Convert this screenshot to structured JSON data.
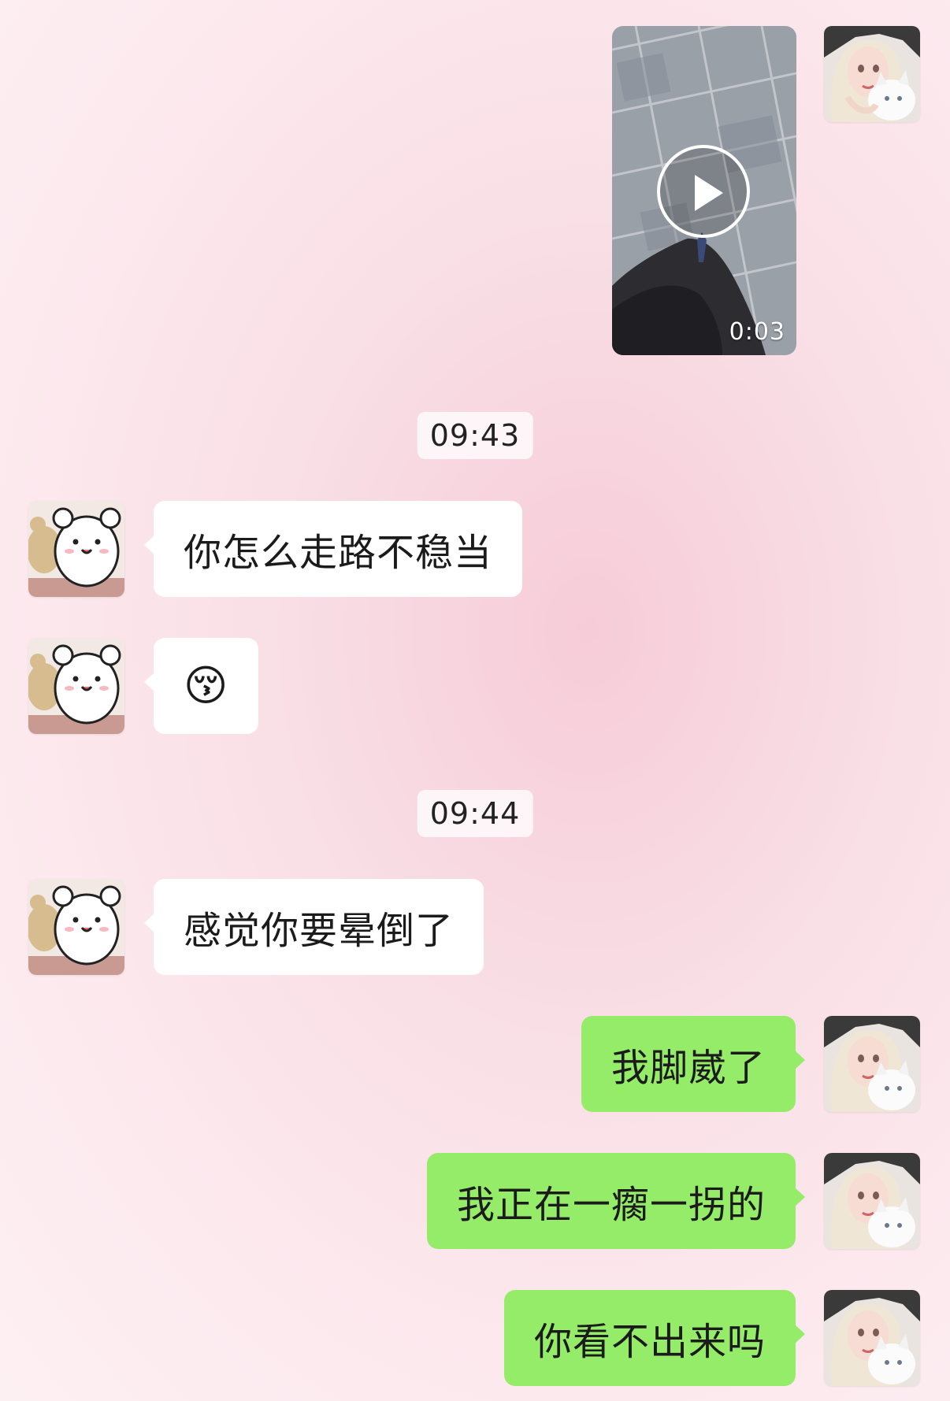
{
  "video": {
    "duration": "0:03"
  },
  "timestamps": {
    "first": "09:43",
    "second": "09:44"
  },
  "messages": [
    {
      "side": "received",
      "text": "你怎么走路不稳当"
    },
    {
      "side": "received",
      "text": "😚"
    },
    {
      "side": "received",
      "text": "感觉你要晕倒了"
    },
    {
      "side": "sent",
      "text": "我脚崴了"
    },
    {
      "side": "sent",
      "text": "我正在一瘸一拐的"
    },
    {
      "side": "sent",
      "text": "你看不出来吗"
    }
  ],
  "colors": {
    "sent_bubble": "#95ec69",
    "received_bubble": "#ffffff",
    "background": "#fbe4ea"
  },
  "icons": {
    "play": "play-icon",
    "contact_avatar": "bear-sticker-avatar",
    "self_avatar": "girl-with-cat-avatar"
  }
}
